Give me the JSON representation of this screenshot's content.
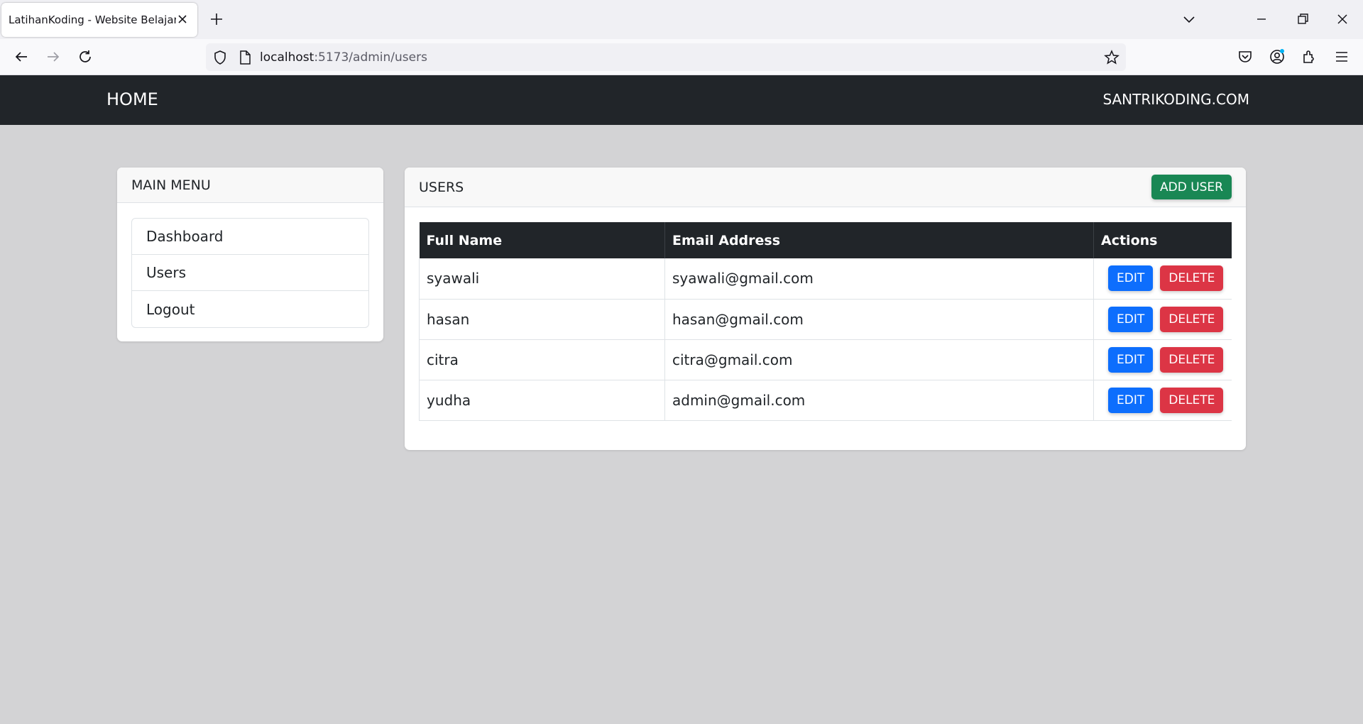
{
  "browser": {
    "tab_title": "LatihanKoding - Website Belajar Coding",
    "url_host": "localhost",
    "url_rest": ":5173/admin/users"
  },
  "app": {
    "brand": "HOME",
    "site_link": "SANTRIKODING.COM"
  },
  "menu": {
    "title": "MAIN MENU",
    "items": [
      {
        "label": "Dashboard"
      },
      {
        "label": "Users"
      },
      {
        "label": "Logout"
      }
    ]
  },
  "users": {
    "title": "USERS",
    "add_label": "ADD USER",
    "columns": [
      "Full Name",
      "Email Address",
      "Actions"
    ],
    "edit_label": "EDIT",
    "delete_label": "DELETE",
    "rows": [
      {
        "name": "syawali",
        "email": "syawali@gmail.com"
      },
      {
        "name": "hasan",
        "email": "hasan@gmail.com"
      },
      {
        "name": "citra",
        "email": "citra@gmail.com"
      },
      {
        "name": "yudha",
        "email": "admin@gmail.com"
      }
    ]
  },
  "colors": {
    "navbar": "#212529",
    "primary": "#0d6efd",
    "danger": "#dc3545",
    "success": "#198754"
  }
}
